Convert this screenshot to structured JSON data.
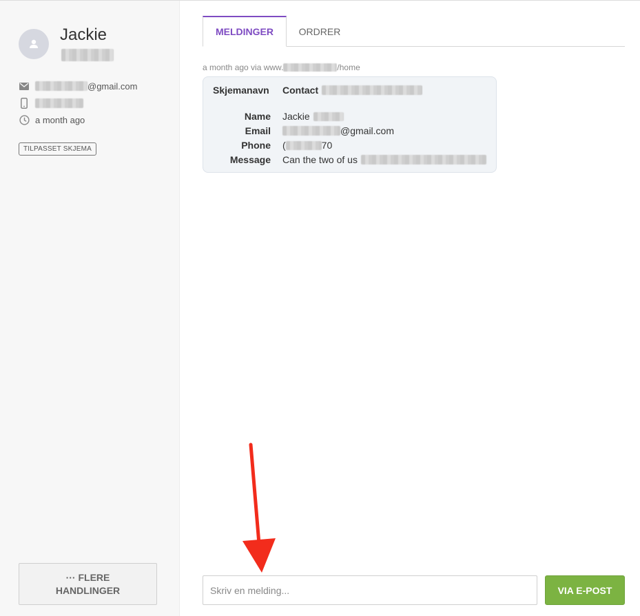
{
  "contact": {
    "name": "Jackie",
    "email_suffix": "@gmail.com",
    "time": "a month ago",
    "tag": "TILPASSET SKJEMA"
  },
  "actions": {
    "more_line1": "··· FLERE",
    "more_line2": "HANDLINGER"
  },
  "tabs": [
    {
      "label": "MELDINGER",
      "active": true
    },
    {
      "label": "ORDRER",
      "active": false
    }
  ],
  "message": {
    "meta_prefix": "a month ago via www.",
    "meta_suffix": "/home",
    "fields": {
      "form_label": "Skjemanavn",
      "form_value": "Contact",
      "name_label": "Name",
      "name_value": "Jackie",
      "email_label": "Email",
      "email_value": "@gmail.com",
      "phone_label": "Phone",
      "phone_value_prefix": "(",
      "phone_value_suffix": "70",
      "message_label": "Message",
      "message_value": "Can the two of us"
    }
  },
  "composer": {
    "placeholder": "Skriv en melding...",
    "send_label": "VIA E-POST"
  },
  "colors": {
    "accent": "#7e4bc2",
    "send": "#7cb342",
    "annotation_arrow": "#f22c1c"
  }
}
